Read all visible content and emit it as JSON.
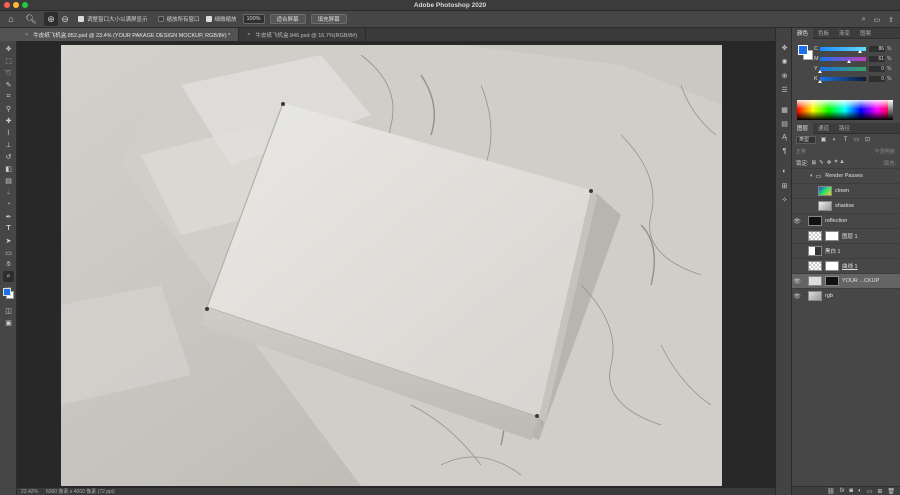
{
  "window": {
    "title": "Adobe Photoshop 2020"
  },
  "options": {
    "resize_windows": "调整窗口大小以满屏显示",
    "zoom_all": "缩放所有窗口",
    "scrubby_zoom": "细微缩放",
    "zoom_value": "100%",
    "fit_screen": "适合屏幕",
    "fill_screen": "填充屏幕"
  },
  "tabs": [
    {
      "label": "牛皮纸飞机盒.852.psd @ 23.4% (YOUR PAKAGE DESIGN MOCKUP, RGB/8#) *"
    },
    {
      "label": "牛皮纸飞机盒.846.psd @ 16.7%(RGB/8#)"
    }
  ],
  "status": {
    "zoom": "23.42%",
    "doc_size": "6000 像素 x 4000 像素 (72 ppi)"
  },
  "color_panel": {
    "tabs": [
      "颜色",
      "色板",
      "渐变",
      "图案"
    ],
    "foreground": "#1a73e8",
    "background": "#ffffff",
    "channels": [
      {
        "label": "C",
        "value": "86"
      },
      {
        "label": "M",
        "value": "61"
      },
      {
        "label": "Y",
        "value": "0"
      },
      {
        "label": "K",
        "value": "0"
      }
    ],
    "unit": "%"
  },
  "layers_panel": {
    "tabs": [
      "图层",
      "通道",
      "路径"
    ],
    "kind_label": "类型",
    "mode_label": "正常",
    "opacity_label": "不透明度:",
    "lock_label": "锁定:",
    "fill_label": "填充:",
    "layers": [
      {
        "name": "Render Passes",
        "visible": false,
        "type": "group"
      },
      {
        "name": "clown",
        "visible": false,
        "type": "layer"
      },
      {
        "name": "shadow",
        "visible": false,
        "type": "layer"
      },
      {
        "name": "reflection",
        "visible": true,
        "type": "layer"
      },
      {
        "name": "图层 1",
        "visible": false,
        "type": "layer"
      },
      {
        "name": "黑白 1",
        "visible": false,
        "type": "adjustment"
      },
      {
        "name": "曲线 1",
        "visible": false,
        "type": "adjustment"
      },
      {
        "name": "YOUR ...CKUP",
        "visible": true,
        "type": "smart"
      },
      {
        "name": "rgb",
        "visible": true,
        "type": "layer"
      }
    ],
    "footer_icons": [
      "link-icon",
      "fx-icon",
      "mask-icon",
      "adjustment-icon",
      "folder-icon",
      "new-layer-icon",
      "trash-icon"
    ]
  }
}
